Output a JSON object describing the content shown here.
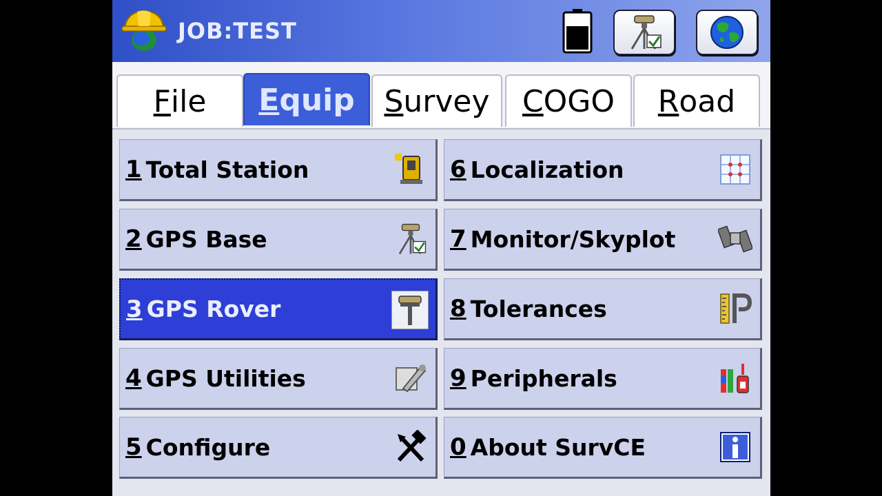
{
  "titlebar": {
    "job_title": "JOB:TEST",
    "icons": {
      "logo": "surveyor-helmet-logo-icon",
      "battery": "battery-icon",
      "gps_status": "gps-base-status-icon",
      "globe": "globe-icon"
    }
  },
  "tabs": [
    {
      "label_u": "F",
      "label_rest": "ile",
      "active": false
    },
    {
      "label_u": "E",
      "label_rest": "quip",
      "active": true
    },
    {
      "label_u": "S",
      "label_rest": "urvey",
      "active": false
    },
    {
      "label_u": "C",
      "label_rest": "OGO",
      "active": false
    },
    {
      "label_u": "R",
      "label_rest": "oad",
      "active": false
    }
  ],
  "menu": {
    "items": [
      {
        "num": "1",
        "label": "Total Station",
        "icon": "total-station-icon"
      },
      {
        "num": "2",
        "label": "GPS Base",
        "icon": "gps-base-icon"
      },
      {
        "num": "3",
        "label": "GPS Rover",
        "icon": "gps-rover-icon",
        "selected": true
      },
      {
        "num": "4",
        "label": "GPS Utilities",
        "icon": "gps-utilities-icon"
      },
      {
        "num": "5",
        "label": "Configure",
        "icon": "tools-icon"
      },
      {
        "num": "6",
        "label": "Localization",
        "icon": "localization-grid-icon"
      },
      {
        "num": "7",
        "label": "Monitor/Skyplot",
        "icon": "satellite-icon"
      },
      {
        "num": "8",
        "label": "Tolerances",
        "icon": "tolerances-icon"
      },
      {
        "num": "9",
        "label": "Peripherals",
        "icon": "peripherals-icon"
      },
      {
        "num": "0",
        "label": "About SurvCE",
        "icon": "info-icon"
      }
    ]
  },
  "colors": {
    "titlebar_start": "#2f4fc8",
    "titlebar_end": "#8ea4ec",
    "active_tab": "#3c5ed8",
    "menu_item": "#ccd1ec",
    "selected_item": "#2d3fd6"
  }
}
